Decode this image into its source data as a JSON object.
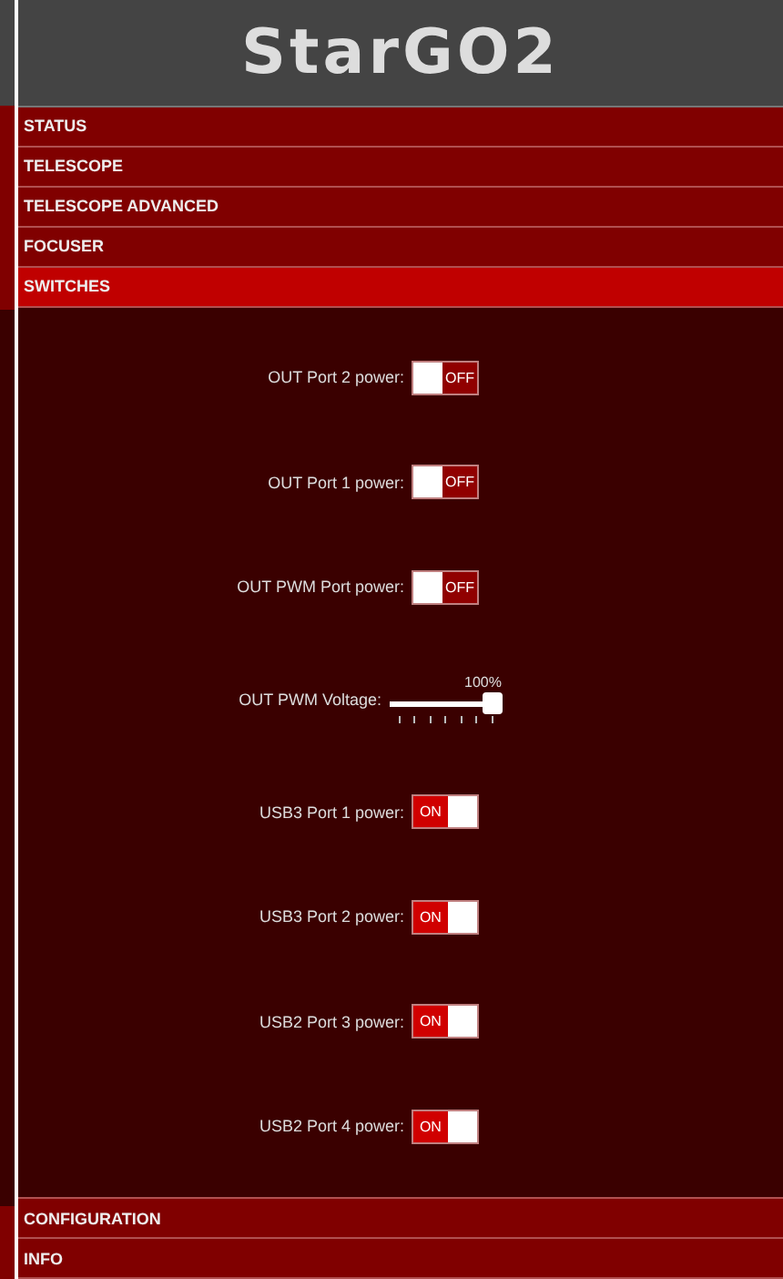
{
  "header": {
    "logo": "StarGO2"
  },
  "nav_top": [
    {
      "label": "STATUS",
      "selected": false
    },
    {
      "label": "TELESCOPE",
      "selected": false
    },
    {
      "label": "TELESCOPE ADVANCED",
      "selected": false
    },
    {
      "label": "FOCUSER",
      "selected": false
    },
    {
      "label": "SWITCHES",
      "selected": true
    }
  ],
  "switches": [
    {
      "kind": "toggle",
      "label": "OUT Port 2 power:",
      "on": false,
      "state_text": "OFF"
    },
    {
      "kind": "toggle",
      "label": "OUT Port 1 power:",
      "on": false,
      "state_text": "OFF"
    },
    {
      "kind": "toggle",
      "label": "OUT PWM Port power:",
      "on": false,
      "state_text": "OFF"
    },
    {
      "kind": "slider",
      "label": "OUT PWM Voltage:",
      "level": 1,
      "reading": "100%"
    },
    {
      "kind": "toggle",
      "label": "USB3 Port 1 power:",
      "on": true,
      "state_text": "ON"
    },
    {
      "kind": "toggle",
      "label": "USB3 Port 2 power:",
      "on": true,
      "state_text": "ON"
    },
    {
      "kind": "toggle",
      "label": "USB2 Port 3 power:",
      "on": true,
      "state_text": "ON"
    },
    {
      "kind": "toggle",
      "label": "USB2 Port 4 power:",
      "on": true,
      "state_text": "ON"
    }
  ],
  "nav_bottom": [
    {
      "label": "CONFIGURATION",
      "selected": false
    },
    {
      "label": "INFO",
      "selected": false
    }
  ]
}
